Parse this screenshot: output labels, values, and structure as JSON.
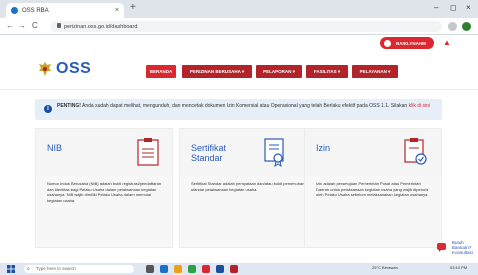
{
  "browser": {
    "tab_title": "OSS RBA",
    "tab_close": "×",
    "new_tab": "+",
    "url": "perizinan.oss.go.id/dashboard",
    "back": "←",
    "forward": "→",
    "reload": "C",
    "win_min": "–",
    "win_max": "◻",
    "win_close": "×"
  },
  "user": {
    "name": "BAIKLYNAHM"
  },
  "header": {
    "logo": "OSS",
    "menu": [
      {
        "label": "BERANDA"
      },
      {
        "label": "PERIZINAN BERUSAHA ▾"
      },
      {
        "label": "PELAPORAN ▾"
      },
      {
        "label": "FASILITAS ▾"
      },
      {
        "label": "PELAYANAN ▾"
      }
    ]
  },
  "banner": {
    "strong": "PENTING!",
    "text": " Anda sudah dapat melihat, mengunduh, dan mencetak dokumen Izin Komersial atau Operasional yang telah Berlaku efektif pada OSS 1.1. Silakan ",
    "link": "klik di sini"
  },
  "cards": [
    {
      "title": "NIB",
      "description": "Nomor Induk Berusaha (NIB) adalah bukti registrasi/pendaftaran dan identitas bagi Pelaku Usaha dalam pelaksanaan kegiatan usahanya. NIB wajib dimiliki Pelaku Usaha dalam memulai kegiatan usaha."
    },
    {
      "title": "Sertifikat Standar",
      "description": "Sertifikat Standar adalah pernyataan dan/atau bukti pemenuhan standar pelaksanaan kegiatan usaha."
    },
    {
      "title": "Izin",
      "description": "Izin adalah persetujuan Pemerintah Pusat atau Pemerintah Daerah untuk pelaksanaan kegiatan usaha yang wajib dipenuhi oleh Pelaku Usaha sebelum melaksanakan kegiatan usahanya."
    }
  ],
  "chat": {
    "label": "Butuh Bantuan? Konsultasi"
  },
  "taskbar": {
    "search_placeholder": "Type here to search",
    "tray_text": "25°C Berawan",
    "clock": "03:10 PM"
  },
  "colors": {
    "brand_red": "#d9282f",
    "brand_blue": "#2a5bb8",
    "banner_bg": "#e6eef8"
  }
}
